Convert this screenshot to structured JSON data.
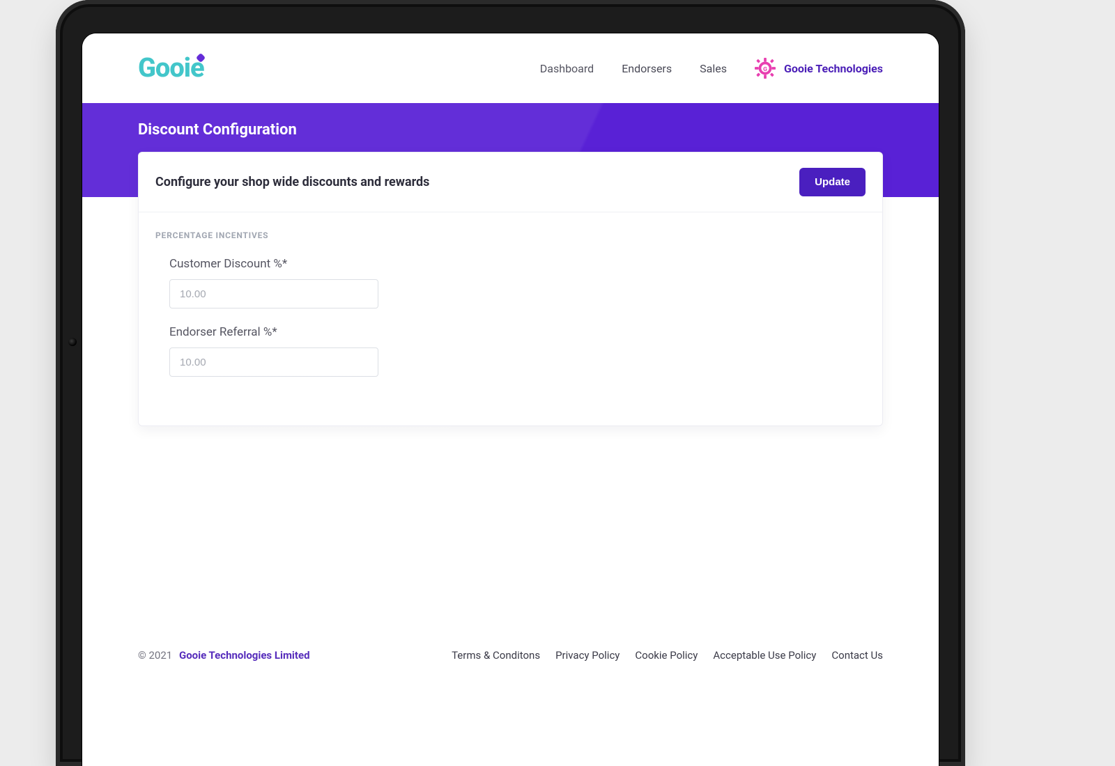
{
  "brand": {
    "logo_text": "Gooie"
  },
  "nav": {
    "items": [
      "Dashboard",
      "Endorsers",
      "Sales"
    ],
    "account_label": "Gooie Technologies"
  },
  "hero": {
    "title": "Discount Configuration"
  },
  "card": {
    "heading": "Configure your shop wide discounts and rewards",
    "update_label": "Update",
    "section_label": "PERCENTAGE INCENTIVES",
    "fields": {
      "customer_discount": {
        "label": "Customer Discount %*",
        "placeholder": "10.00"
      },
      "endorser_referral": {
        "label": "Endorser Referral %*",
        "placeholder": "10.00"
      }
    }
  },
  "footer": {
    "copyright_prefix": "© 2021",
    "company": "Gooie Technologies Limited",
    "links": [
      "Terms & Conditons",
      "Privacy Policy",
      "Cookie Policy",
      "Acceptable Use Policy",
      "Contact Us"
    ]
  }
}
